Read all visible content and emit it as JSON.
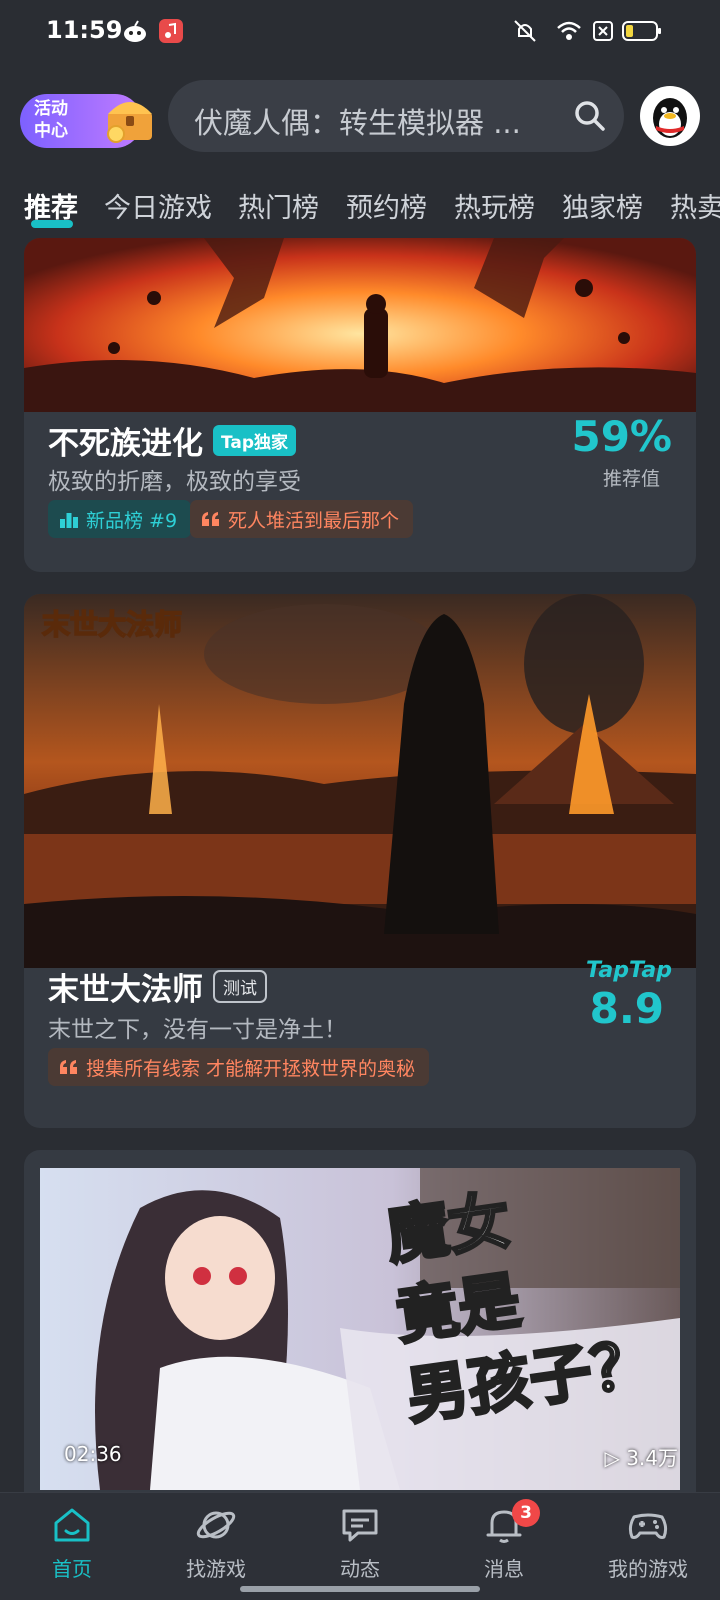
{
  "status_bar": {
    "time": "11:59"
  },
  "header": {
    "promo_label": "活动\n中心",
    "search_placeholder": "伏魔人偶：转生模拟器 ..."
  },
  "tabs": [
    {
      "label": "推荐",
      "active": true
    },
    {
      "label": "今日游戏"
    },
    {
      "label": "热门榜"
    },
    {
      "label": "预约榜"
    },
    {
      "label": "热玩榜"
    },
    {
      "label": "独家榜"
    },
    {
      "label": "热卖"
    }
  ],
  "cards": [
    {
      "title": "不死族进化",
      "badge": "Tap独家",
      "subtitle": "极致的折磨，极致的享受",
      "score": "59%",
      "score_label": "推荐值",
      "tags": [
        {
          "icon": "rank-icon",
          "text": "新品榜 #9"
        },
        {
          "icon": "quote-icon",
          "text": "死人堆活到最后那个"
        }
      ]
    },
    {
      "title": "末世大法师",
      "badge": "测试",
      "banner_logo": "末世大法师",
      "subtitle": "末世之下，没有一寸是净土！",
      "score_brand": "TapTap",
      "score": "8.9",
      "tags": [
        {
          "icon": "quote-icon",
          "text": "搜集所有线索 才能解开拯救世界的奥秘"
        }
      ]
    },
    {
      "banner_text": "魔女竟是男孩子？",
      "video_time": "02:36",
      "video_views": "3.4万"
    }
  ],
  "bottom_nav": [
    {
      "label": "首页",
      "icon": "home-icon",
      "active": true
    },
    {
      "label": "找游戏",
      "icon": "planet-icon"
    },
    {
      "label": "动态",
      "icon": "chat-icon"
    },
    {
      "label": "消息",
      "icon": "bell-icon",
      "badge": "3"
    },
    {
      "label": "我的游戏",
      "icon": "gamepad-icon"
    }
  ],
  "colors": {
    "accent": "#19c0c6",
    "background": "#2a2d33",
    "card": "#353a42",
    "quote": "#ff8560"
  }
}
